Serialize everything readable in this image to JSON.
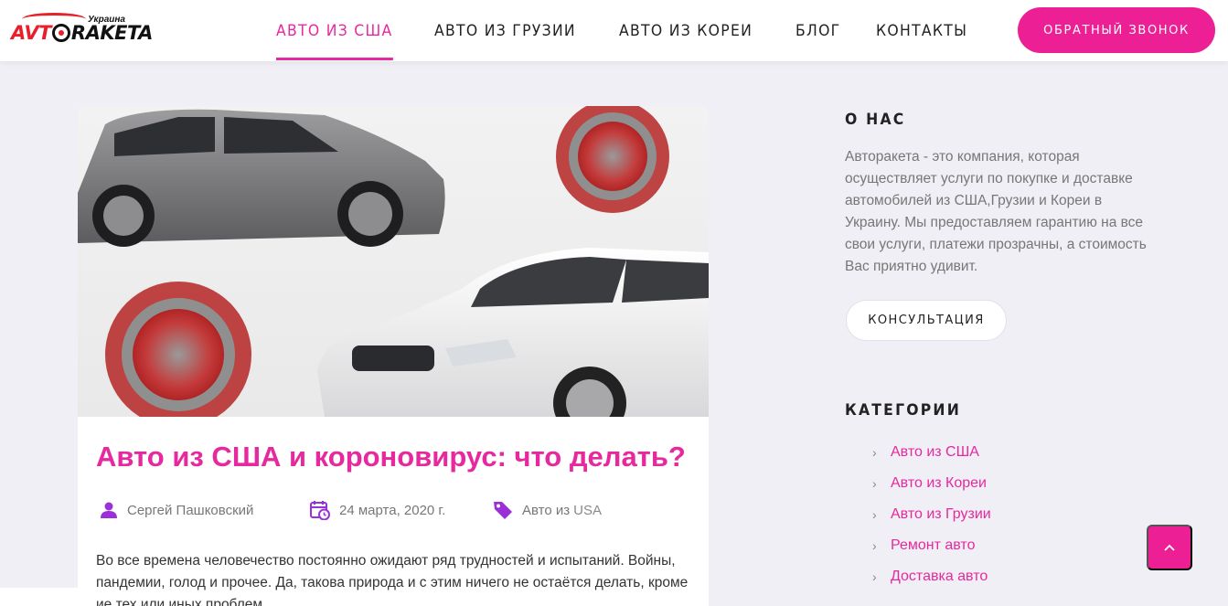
{
  "header": {
    "logo": {
      "brand": "AVTORAKETA",
      "part1": "AVT",
      "part2": "RAKETA",
      "tagline": "Украина"
    },
    "nav": [
      {
        "label": "АВТО ИЗ США",
        "active": true
      },
      {
        "label": "АВТО ИЗ ГРУЗИИ",
        "active": false
      },
      {
        "label": "АВТО ИЗ КОРЕИ",
        "active": false
      },
      {
        "label": "БЛОГ",
        "active": false
      },
      {
        "label": "КОНТАКТЫ",
        "active": false
      }
    ],
    "callback_label": "ОБРАТНЫЙ ЗВОНОК"
  },
  "post": {
    "image": "cars-and-coronavirus-image",
    "title": "Авто из США и короновирус: что делать?",
    "author": "Сергей Пашковский",
    "date": "24 марта, 2020 г.",
    "category_prefix": "Авто из",
    "category_link": "USA",
    "excerpt": "Во все времена человечество постоянно ожидают ряд трудностей и испытаний. Войны, пандемии, голод и прочее. Да, такова природа и с этим ничего не остаётся делать, кроме ие тех или иных проблем."
  },
  "sidebar": {
    "about_title": "О НАС",
    "about_text": "Авторакета - это компания, которая осуществляет услуги по покупке и доставке автомобилей из США,Грузии и Кореи в Украину. Мы предоставляем гарантию на все свои услуги, платежи прозрачны, а стоимость Вас приятно удивит.",
    "consult_label": "КОНСУЛЬТАЦИЯ",
    "categories_title": "КАТЕГОРИИ",
    "categories": [
      {
        "label": "Авто из США"
      },
      {
        "label": "Авто из Кореи"
      },
      {
        "label": "Авто из Грузии"
      },
      {
        "label": "Ремонт авто"
      },
      {
        "label": "Доставка авто"
      }
    ]
  },
  "scroll_top_icon": "chevron-up-icon",
  "colors": {
    "accent": "#ec1f94",
    "link": "#e6299e",
    "background": "#efeff5",
    "meta_icon": "#9b30d9"
  }
}
